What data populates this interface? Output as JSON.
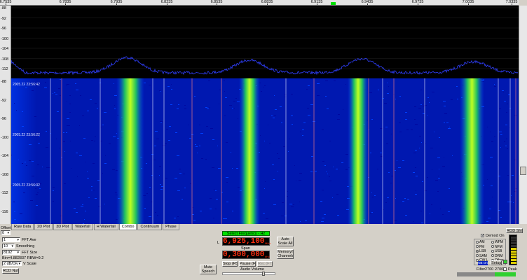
{
  "ruler": {
    "ticks": [
      "6.7535",
      "6.7835",
      "6.7935",
      "6.8235",
      "6.8535",
      "6.8835",
      "6.9135",
      "6.9435",
      "6.9735",
      "7.0035",
      "7.0335"
    ]
  },
  "yscale": {
    "spectrum_labels": [
      "-88",
      "-92",
      "-96",
      "-100",
      "-104",
      "-108",
      "-112"
    ],
    "waterfall_labels": [
      "-88",
      "-92",
      "-96",
      "-100",
      "-104",
      "-108",
      "-112",
      "-116"
    ]
  },
  "waterfall_timestamps": [
    "2005.22 23:56:42",
    "2005.22 23:56:22",
    "2005.22 23:56:02"
  ],
  "tabs": [
    "Raw Data",
    "2D Plot",
    "3D Plot",
    "Waterfall",
    "H Waterfall",
    "Combo",
    "Continuum",
    "Phase"
  ],
  "active_tab": "Combo",
  "left_panel": {
    "offset_label": "Offset",
    "offset_value": "0",
    "fft_avg_value": "1",
    "fft_avg_label": "FFT Ave",
    "smoothing_value": "10",
    "smoothing_label": "Smoothing",
    "fft_size_value": "8192",
    "fft_size_label": "FFT Size",
    "info_text": "Bin=4.882837 RBW=9.2",
    "vscale_value": "2 dB/Div",
    "vscale_label": "V Scale",
    "rcd_button": "RCD Null"
  },
  "center_panel": {
    "mute_label": "Mute Speech",
    "select_freq_label": "Select Frequency - Hz",
    "l_label": "L",
    "frequency": "6,925,100",
    "span_label": "Span",
    "span": "0,300,000",
    "freq_unit": "MHz",
    "span_unit": "kHz",
    "auto_scale": "Auto Scale All",
    "memory_channels": "Memory/M Channels",
    "stop_button": "Stop (F5)",
    "pause_button": "Pause (F6)",
    "rec_button": "Rec (F7)",
    "audio_volume": "Audio Volume"
  },
  "right_panel": {
    "reset_button": "ROD Shift",
    "demod_on_label": "Demod On",
    "modes": [
      {
        "label": "AM",
        "on": false
      },
      {
        "label": "WFM",
        "on": false
      },
      {
        "label": "FM",
        "on": false
      },
      {
        "label": "NFM",
        "on": false
      },
      {
        "label": "LSB",
        "on": true
      },
      {
        "label": "USB",
        "on": false
      },
      {
        "label": "SAM",
        "on": false
      },
      {
        "label": "DRM",
        "on": false
      },
      {
        "label": "CW-L",
        "on": false
      },
      {
        "label": "Other",
        "on": false
      }
    ],
    "nb_badge": "NB On",
    "setup_button": "Setup",
    "filter_label": "Filter",
    "filter_values": [
      "2700",
      "2700"
    ],
    "peak_label": "Peak"
  },
  "colors": {
    "spectrum_trace": "#3040ff",
    "waterfall_bg": "#0010b0",
    "lcd_text": "#ff3010",
    "select_bar": "#00e000"
  }
}
